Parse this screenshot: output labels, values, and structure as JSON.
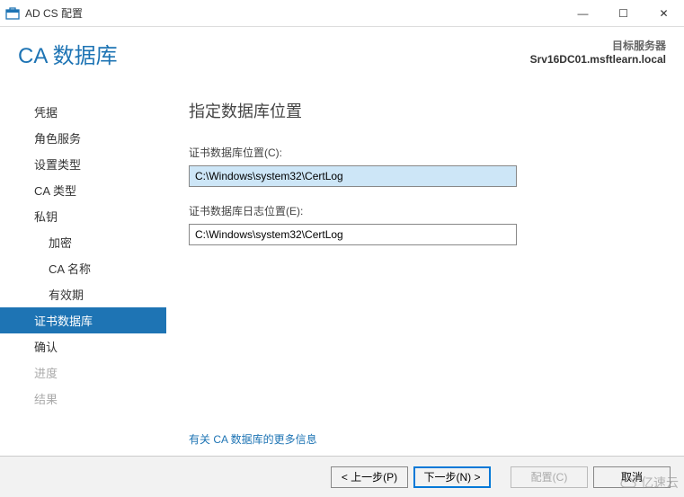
{
  "window": {
    "title": "AD CS 配置",
    "minimize": "—",
    "maximize": "☐",
    "close": "✕"
  },
  "header": {
    "page_title": "CA 数据库",
    "server_label": "目标服务器",
    "server_name": "Srv16DC01.msftlearn.local"
  },
  "sidebar": {
    "items": [
      {
        "label": "凭据",
        "indent": 0,
        "state": "normal"
      },
      {
        "label": "角色服务",
        "indent": 0,
        "state": "normal"
      },
      {
        "label": "设置类型",
        "indent": 0,
        "state": "normal"
      },
      {
        "label": "CA 类型",
        "indent": 0,
        "state": "normal"
      },
      {
        "label": "私钥",
        "indent": 0,
        "state": "normal"
      },
      {
        "label": "加密",
        "indent": 1,
        "state": "normal"
      },
      {
        "label": "CA 名称",
        "indent": 1,
        "state": "normal"
      },
      {
        "label": "有效期",
        "indent": 1,
        "state": "normal"
      },
      {
        "label": "证书数据库",
        "indent": 0,
        "state": "active"
      },
      {
        "label": "确认",
        "indent": 0,
        "state": "normal"
      },
      {
        "label": "进度",
        "indent": 0,
        "state": "disabled"
      },
      {
        "label": "结果",
        "indent": 0,
        "state": "disabled"
      }
    ]
  },
  "content": {
    "title": "指定数据库位置",
    "db_label": "证书数据库位置(C):",
    "db_value": "C:\\Windows\\system32\\CertLog",
    "log_label": "证书数据库日志位置(E):",
    "log_value": "C:\\Windows\\system32\\CertLog",
    "more_link": "有关 CA 数据库的更多信息"
  },
  "buttons": {
    "prev": "< 上一步(P)",
    "next": "下一步(N) >",
    "configure": "配置(C)",
    "cancel": "取消"
  },
  "watermark": "亿速云"
}
